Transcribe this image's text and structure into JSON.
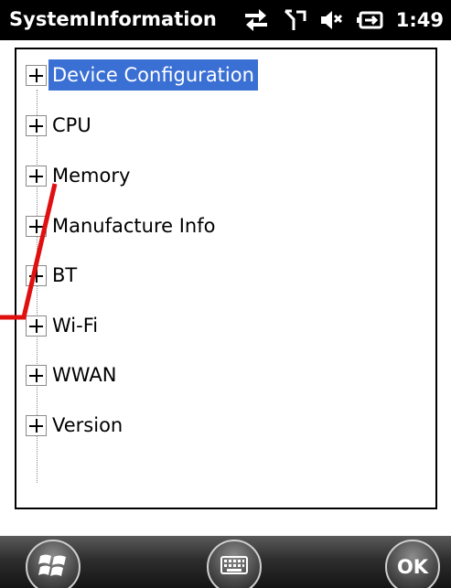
{
  "window": {
    "title": "SystemInformation",
    "clock": "1:49"
  },
  "status_icons": [
    "connectivity-arrows-icon",
    "no-signal-icon",
    "speaker-muted-icon",
    "battery-charging-icon"
  ],
  "tree": {
    "items": [
      {
        "label": "Device Configuration",
        "selected": true
      },
      {
        "label": "CPU",
        "selected": false
      },
      {
        "label": "Memory",
        "selected": false
      },
      {
        "label": "Manufacture Info",
        "selected": false
      },
      {
        "label": "BT",
        "selected": false
      },
      {
        "label": "Wi-Fi",
        "selected": false
      },
      {
        "label": "WWAN",
        "selected": false
      },
      {
        "label": "Version",
        "selected": false
      }
    ]
  },
  "bottom_bar": {
    "ok_label": "OK",
    "buttons": [
      "windows-start-icon",
      "keyboard-icon",
      "ok-button"
    ]
  },
  "colors": {
    "selection": "#3a6fd4",
    "annotation": "#e01010"
  }
}
